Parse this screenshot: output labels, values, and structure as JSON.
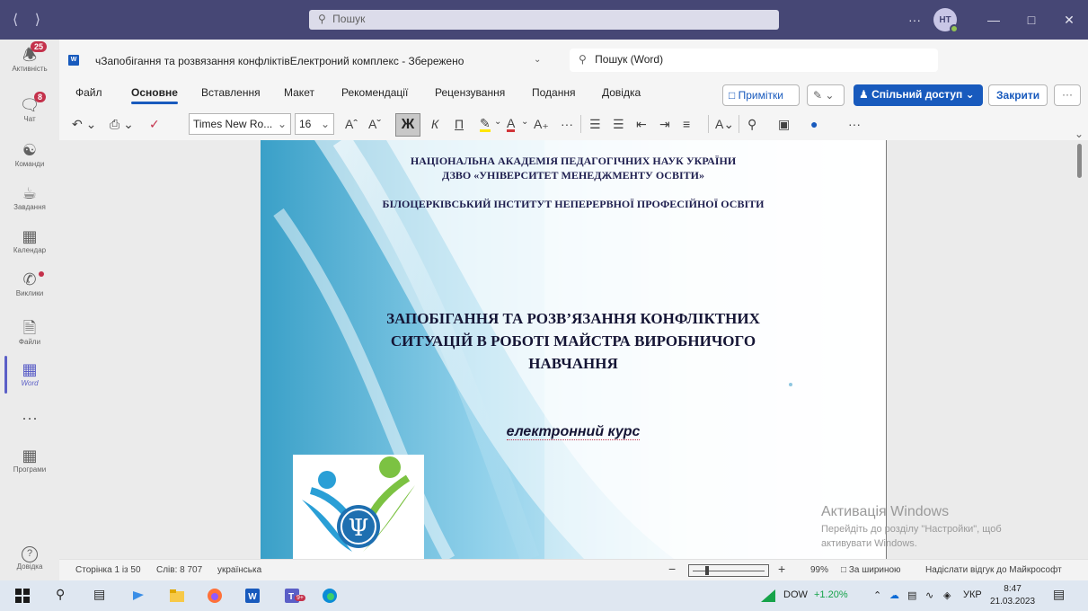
{
  "titlebar": {
    "search_placeholder": "Пошук",
    "avatar_initials": "НТ",
    "more": "···"
  },
  "rail": {
    "items": [
      {
        "label": "Активність",
        "icon": "bell-icon",
        "badge": "25"
      },
      {
        "label": "Чат",
        "icon": "chat-icon",
        "badge": "8"
      },
      {
        "label": "Команди",
        "icon": "teams-icon"
      },
      {
        "label": "Завдання",
        "icon": "tasks-icon"
      },
      {
        "label": "Календар",
        "icon": "calendar-icon"
      },
      {
        "label": "Виклики",
        "icon": "phone-icon"
      },
      {
        "label": "Файли",
        "icon": "file-icon"
      },
      {
        "label": "Word",
        "icon": "word-icon"
      },
      {
        "label": "···",
        "icon": "more-icon"
      },
      {
        "label": "Програми",
        "icon": "apps-icon"
      }
    ],
    "help_label": "Довідка"
  },
  "word": {
    "logo": "W",
    "doc_title": "чЗапобігання та розвязання конфліктівЕлектроний комплекс - Збережено",
    "search_text": "Пошук (Word)",
    "menu": [
      "Файл",
      "Основне",
      "Вставлення",
      "Макет",
      "Рекомендації",
      "Рецензування",
      "Подання",
      "Довідка"
    ],
    "active_menu": "Основне",
    "notes_label": "Примітки",
    "share_label": "Спільний доступ",
    "close_label": "Закрити",
    "more_label": "···",
    "font_name": "Times New Ro...",
    "font_size": "16",
    "bold": "Ж",
    "italic": "К",
    "underline": "П"
  },
  "document": {
    "line1": "НАЦІОНАЛЬНА АКАДЕМІЯ ПЕДАГОГІЧНИХ НАУК УКРАЇНИ",
    "line2": "ДЗВО «УНІВЕРСИТЕТ МЕНЕДЖМЕНТУ ОСВІТИ»",
    "line3": "БІЛОЦЕРКІВСЬКИЙ ІНСТИТУТ НЕПЕРЕРВНОЇ ПРОФЕСІЙНОЇ ОСВІТИ",
    "title_l1": "ЗАПОБІГАННЯ ТА РОЗВ’ЯЗАННЯ КОНФЛІКТНИХ",
    "title_l2": "СИТУАЦІЙ В РОБОТІ МАЙСТРА ВИРОБНИЧОГО",
    "title_l3": "НАВЧАННЯ",
    "course": "електронний курс",
    "logo_symbol": "Ψ"
  },
  "watermark": {
    "line1": "Активація Windows",
    "line2": "Перейдіть до розділу \"Настройки\", щоб",
    "line3": "активувати Windows."
  },
  "statusbar": {
    "page": "Сторінка 1 із 50",
    "words": "Слів: 8 707",
    "lang": "українська",
    "zoom_minus": "−",
    "zoom_plus": "+",
    "zoom": "99%",
    "fit": "За шириною",
    "feedback": "Надіслати відгук до Майкрософт"
  },
  "taskbar": {
    "stock_name": "DOW",
    "stock_change": "+1.20%",
    "lang": "УКР",
    "time": "8:47",
    "date": "21.03.2023",
    "teams_badge": "9+"
  },
  "colors": {
    "titlebar": "#464775",
    "accent": "#5b5fc7",
    "word_blue": "#185abd"
  }
}
